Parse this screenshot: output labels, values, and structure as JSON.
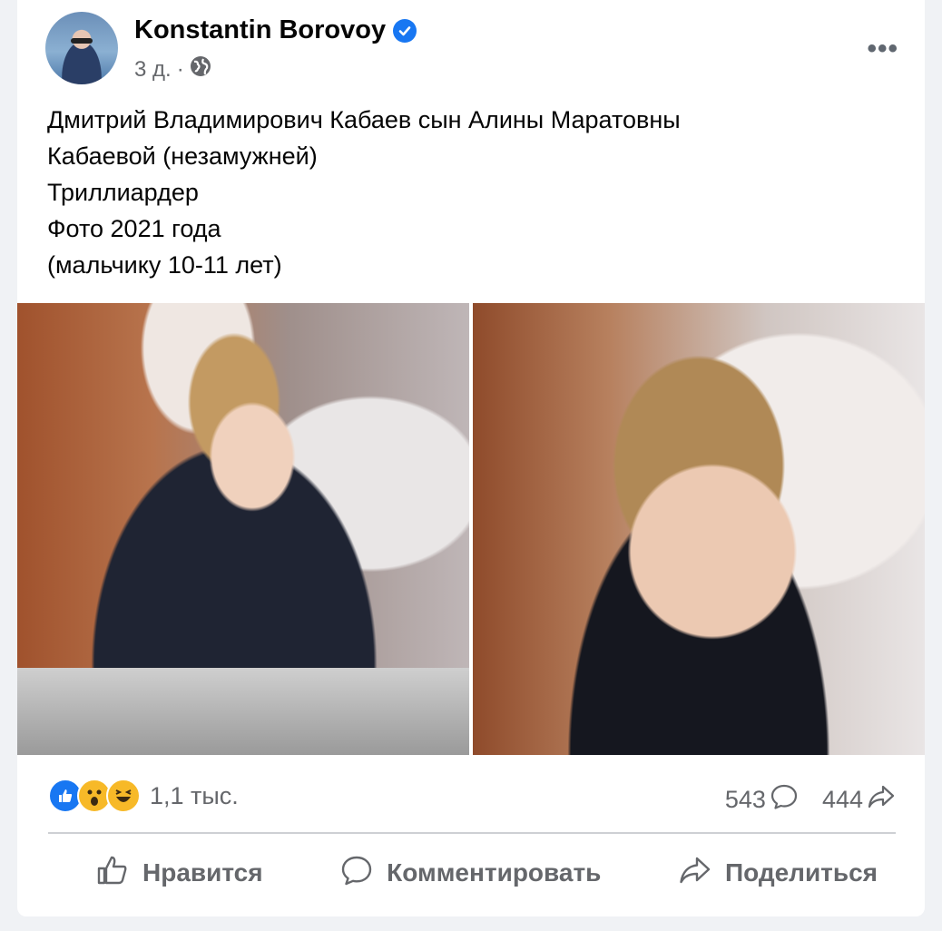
{
  "post": {
    "author": "Konstantin Borovoy",
    "timestamp": "3 д.",
    "separator": "·",
    "audience_icon": "globe-icon",
    "verified_icon": "verified-badge-icon",
    "text_lines": [
      "Дмитрий Владимирович Кабаев сын Алины Маратовны",
      "Кабаевой (незамужней)",
      "Триллиардер",
      "Фото 2021 года",
      "(мальчику  10-11 лет)"
    ]
  },
  "stats": {
    "reactions_count": "1,1 тыс.",
    "reaction_icons": [
      "like-reaction-icon",
      "wow-reaction-icon",
      "haha-reaction-icon"
    ],
    "comments_count": "543",
    "shares_count": "444"
  },
  "actions": {
    "like_label": "Нравится",
    "comment_label": "Комментировать",
    "share_label": "Поделиться"
  },
  "colors": {
    "accent": "#1877f2",
    "secondary_text": "#65676b",
    "reaction_yellow": "#f7b928"
  }
}
